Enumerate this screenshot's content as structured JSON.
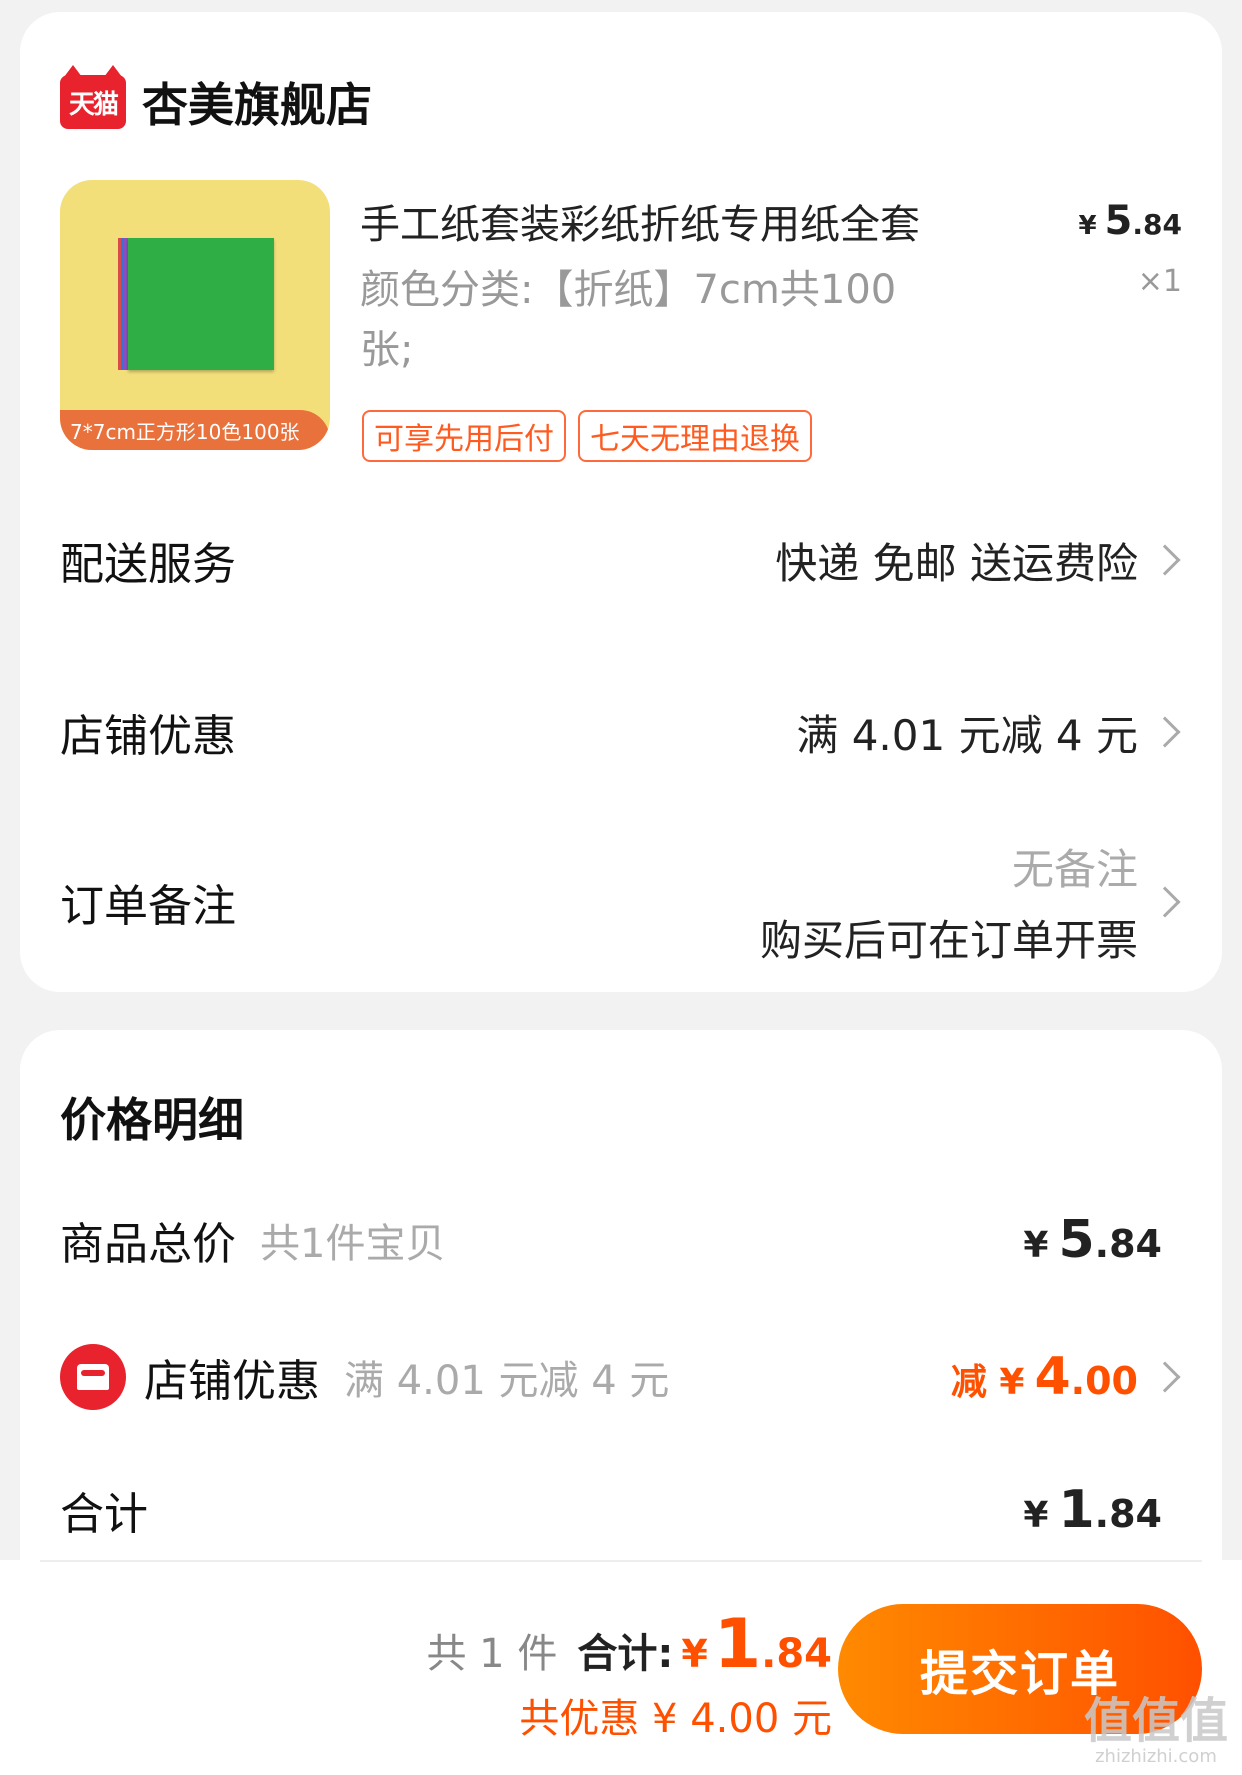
{
  "shop": {
    "badge": "天猫",
    "name": "杏美旗舰店"
  },
  "product": {
    "thumb_caption": "7*7cm正方形10色100张",
    "title": "手工纸套装彩纸折纸专用纸全套",
    "spec_line1": "颜色分类:【折纸】7cm共100",
    "spec_line2": "张;",
    "price_currency": "¥",
    "price_int": "5",
    "price_dec": ".84",
    "qty": "×1",
    "tags": [
      "可享先用后付",
      "七天无理由退换"
    ],
    "paper_colors": [
      "#d94b4b",
      "#3f6fd6",
      "#8a4fbf",
      "#2eae45"
    ]
  },
  "delivery": {
    "label": "配送服务",
    "value": "快递 免邮 送运费险"
  },
  "shop_discount": {
    "label": "店铺优惠",
    "value": "满 4.01 元减 4 元"
  },
  "remark": {
    "label": "订单备注",
    "value": "无备注",
    "invoice": "购买后可在订单开票"
  },
  "price_detail": {
    "title": "价格明细",
    "goods_total": {
      "label": "商品总价",
      "note": "共1件宝贝",
      "currency": "¥",
      "int": "5",
      "dec": ".84"
    },
    "discount": {
      "label": "店铺优惠",
      "note": "满 4.01 元减 4 元",
      "prefix": "减 ¥",
      "int": "4",
      "dec": ".00"
    },
    "sum": {
      "label": "合计",
      "currency": "¥",
      "int": "1",
      "dec": ".84"
    }
  },
  "bottom": {
    "count": "共 1 件",
    "total_label": "合计:",
    "currency": "¥",
    "total_int": "1",
    "total_dec": ".84",
    "saved": "共优惠 ¥ 4.00 元",
    "submit": "提交订单"
  },
  "watermark": {
    "main": "值值值",
    "sub": "zhizhizhi.com"
  },
  "colors": {
    "accent": "#ff5000",
    "tmall_red": "#e8232d",
    "tag_border": "#ff6a3d"
  }
}
